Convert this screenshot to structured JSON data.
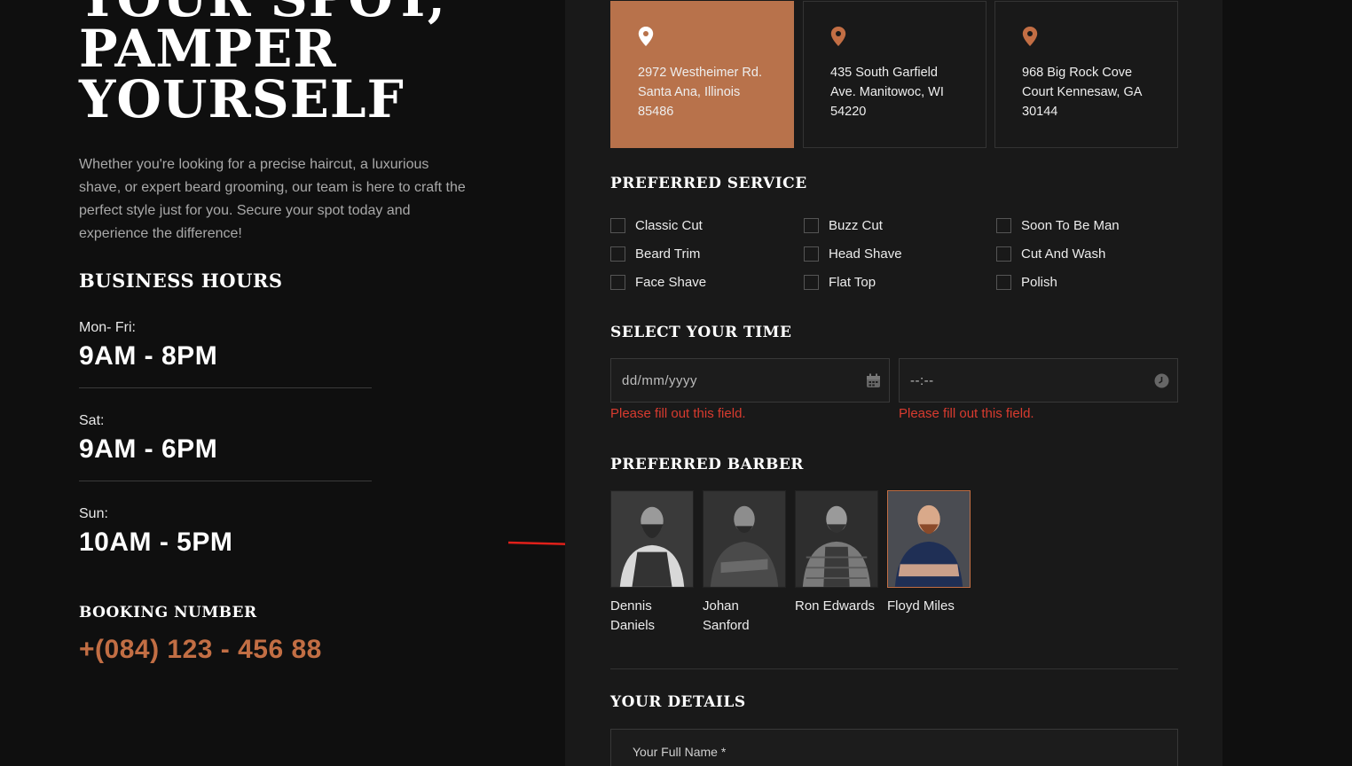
{
  "hero": {
    "title_line1": "YOUR SPOT,",
    "title_line2": "PAMPER",
    "title_line3": "YOURSELF",
    "description": "Whether you're looking for a precise haircut, a luxurious shave, or expert beard grooming, our team is here to craft the perfect style just for you. Secure your spot today and experience the difference!"
  },
  "hours": {
    "title": "BUSINESS HOURS",
    "items": [
      {
        "day": "Mon- Fri:",
        "time": "9AM - 8PM"
      },
      {
        "day": "Sat:",
        "time": "9AM - 6PM"
      },
      {
        "day": "Sun:",
        "time": "10AM - 5PM"
      }
    ]
  },
  "booking": {
    "title": "BOOKING NUMBER",
    "number": "+(084) 123 - 456 88"
  },
  "locations": [
    {
      "address": "2972 Westheimer Rd. Santa Ana, Illinois 85486",
      "selected": true,
      "icon": "map-pin-icon"
    },
    {
      "address": "435 South Garfield Ave. Manitowoc, WI 54220",
      "selected": false,
      "icon": "map-pin-icon"
    },
    {
      "address": "968 Big Rock Cove Court Kennesaw, GA 30144",
      "selected": false,
      "icon": "map-pin-icon"
    }
  ],
  "service": {
    "title": "PREFERRED SERVICE",
    "options": [
      "Classic Cut",
      "Buzz Cut",
      "Soon To Be Man",
      "Beard Trim",
      "Head Shave",
      "Cut And Wash",
      "Face Shave",
      "Flat Top",
      "Polish"
    ]
  },
  "time": {
    "title": "SELECT YOUR TIME",
    "date_placeholder": "dd/mm/yyyy",
    "time_placeholder": "--:--",
    "error": "Please fill out this field."
  },
  "barber": {
    "title": "PREFERRED BARBER",
    "options": [
      {
        "name": "Dennis Daniels",
        "selected": false
      },
      {
        "name": "Johan Sanford",
        "selected": false
      },
      {
        "name": "Ron Edwards",
        "selected": false
      },
      {
        "name": "Floyd Miles",
        "selected": true
      }
    ]
  },
  "details": {
    "title": "YOUR DETAILS",
    "full_name_placeholder": "Your Full Name *"
  },
  "colors": {
    "accent": "#c26e44",
    "error": "#d83b2f",
    "background": "#0f0f0f",
    "panel": "#191919"
  }
}
